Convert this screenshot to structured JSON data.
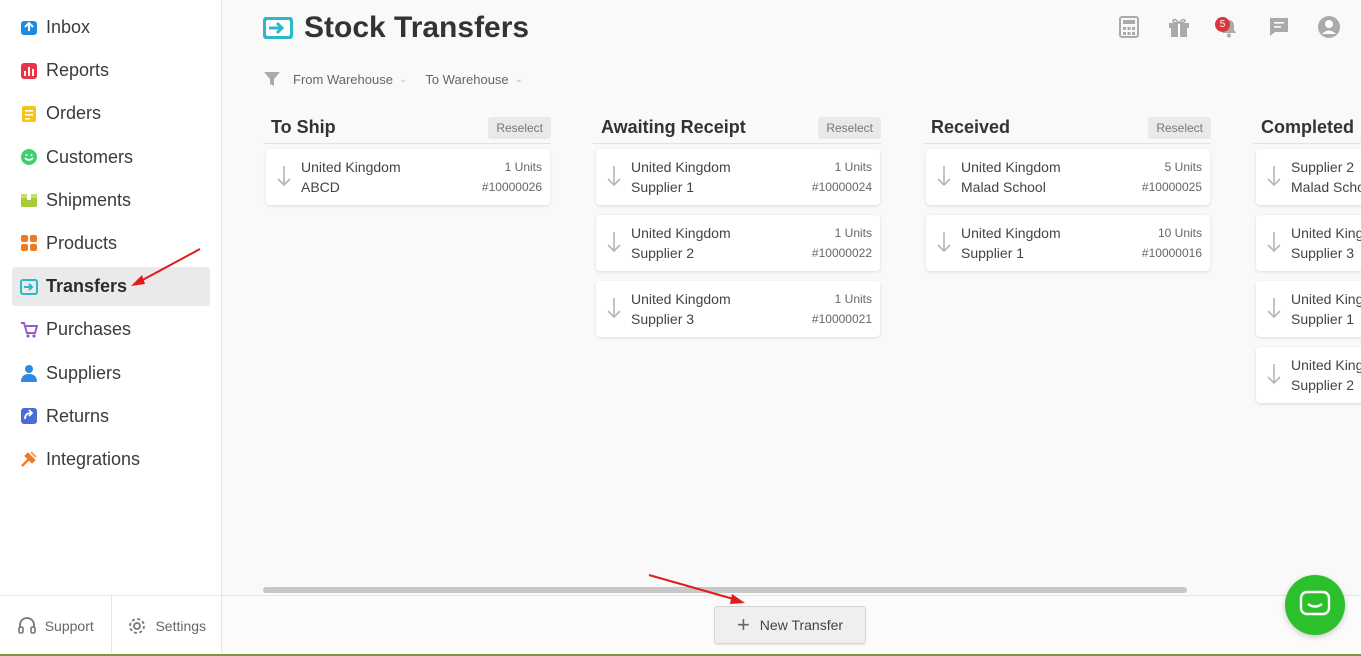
{
  "sidebar": {
    "items": [
      {
        "label": "Inbox",
        "icon": "inbox-icon",
        "color": "#1e8be0"
      },
      {
        "label": "Reports",
        "icon": "reports-icon",
        "color": "#e8334a"
      },
      {
        "label": "Orders",
        "icon": "orders-icon",
        "color": "#f5c518"
      },
      {
        "label": "Customers",
        "icon": "customers-icon",
        "color": "#3ecf6e"
      },
      {
        "label": "Shipments",
        "icon": "shipments-icon",
        "color": "#a8c93a"
      },
      {
        "label": "Products",
        "icon": "products-icon",
        "color": "#f07a1f"
      },
      {
        "label": "Transfers",
        "icon": "transfers-icon",
        "color": "#2bb8c9",
        "active": true
      },
      {
        "label": "Purchases",
        "icon": "purchases-icon",
        "color": "#9b59d0"
      },
      {
        "label": "Suppliers",
        "icon": "suppliers-icon",
        "color": "#2b8be0"
      },
      {
        "label": "Returns",
        "icon": "returns-icon",
        "color": "#4a6cd6"
      },
      {
        "label": "Integrations",
        "icon": "integrations-icon",
        "color": "#f07a1f"
      }
    ],
    "footer": {
      "support": "Support",
      "settings": "Settings"
    }
  },
  "header": {
    "title": "Stock Transfers",
    "notification_count": "5"
  },
  "filters": {
    "from": "From Warehouse",
    "to": "To Warehouse"
  },
  "columns": [
    {
      "title": "To Ship",
      "reselect": "Reselect",
      "cards": [
        {
          "line1": "United Kingdom",
          "line2": "ABCD",
          "units": "1 Units",
          "number": "#10000026"
        }
      ]
    },
    {
      "title": "Awaiting Receipt",
      "reselect": "Reselect",
      "cards": [
        {
          "line1": "United Kingdom",
          "line2": "Supplier 1",
          "units": "1 Units",
          "number": "#10000024"
        },
        {
          "line1": "United Kingdom",
          "line2": "Supplier 2",
          "units": "1 Units",
          "number": "#10000022"
        },
        {
          "line1": "United Kingdom",
          "line2": "Supplier 3",
          "units": "1 Units",
          "number": "#10000021"
        }
      ]
    },
    {
      "title": "Received",
      "reselect": "Reselect",
      "cards": [
        {
          "line1": "United Kingdom",
          "line2": "Malad School",
          "units": "5 Units",
          "number": "#10000025"
        },
        {
          "line1": "United Kingdom",
          "line2": "Supplier 1",
          "units": "10 Units",
          "number": "#10000016"
        }
      ]
    },
    {
      "title": "Completed",
      "reselect": "",
      "cards": [
        {
          "line1": "Supplier 2",
          "line2": "Malad School",
          "units": "",
          "number": ""
        },
        {
          "line1": "United Kingdom",
          "line2": "Supplier 3",
          "units": "",
          "number": ""
        },
        {
          "line1": "United Kingdom",
          "line2": "Supplier 1",
          "units": "",
          "number": ""
        },
        {
          "line1": "United Kingdom",
          "line2": "Supplier 2",
          "units": "",
          "number": ""
        }
      ]
    }
  ],
  "new_transfer_label": "New Transfer",
  "colors": {
    "accent": "#2bb8c9",
    "chat": "#2bc02c",
    "badge": "#d9373f",
    "annotation": "#e21b1b"
  }
}
